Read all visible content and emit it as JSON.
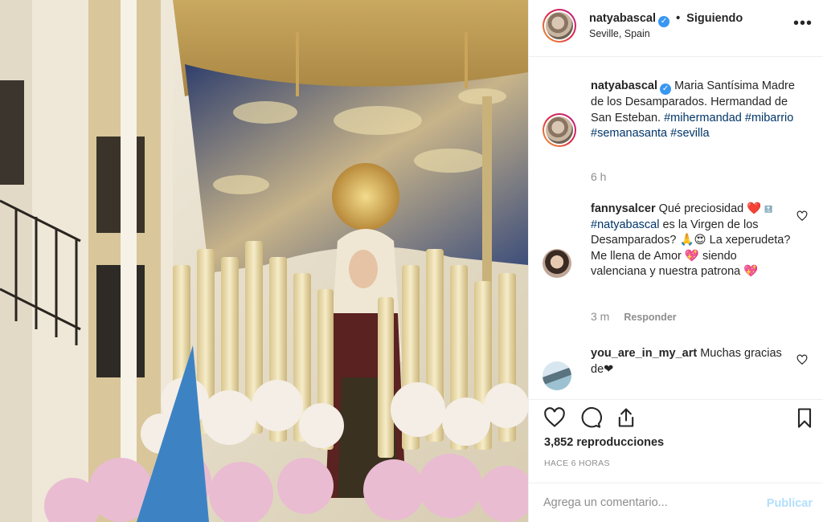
{
  "post": {
    "username": "natyabascal",
    "follow_status": "Siguiendo",
    "dot": "•",
    "location": "Seville, Spain",
    "more_icon": "more-dots-icon"
  },
  "caption": {
    "username": "natyabascal",
    "text": "Maria Santísima Madre de los Desamparados. Hermandad de San Esteban.",
    "hashtags": [
      "#mihermandad",
      "#mibarrio",
      "#semanasanta",
      "#sevilla"
    ],
    "time": "6 h"
  },
  "comments": [
    {
      "username": "fannysalcer",
      "text_a": "Qué preciosidad",
      "emoji_a": "❤️",
      "mention_icon": "🔝",
      "mention": "#natyabascal",
      "text_b": "es la Virgen de los Desamparados?",
      "emoji_b": "🙏😍",
      "text_c": "La xeperudeta? Me llena de Amor",
      "emoji_c": "💖",
      "text_d": "siendo valenciana y nuestra patrona",
      "emoji_d": "💖",
      "time": "3 m",
      "reply_label": "Responder"
    },
    {
      "username": "you_are_in_my_art",
      "text": "Muchas gracias de",
      "emoji": "❤"
    }
  ],
  "actions": {
    "views": "3,852 reproducciones",
    "posted": "HACE 6 HORAS"
  },
  "add_comment": {
    "placeholder": "Agrega un comentario...",
    "publish_label": "Publicar"
  },
  "colors": {
    "link": "#003569",
    "verified": "#3897f0",
    "publish_disabled": "#b2dffc",
    "secondary_text": "#8e8e8e"
  }
}
